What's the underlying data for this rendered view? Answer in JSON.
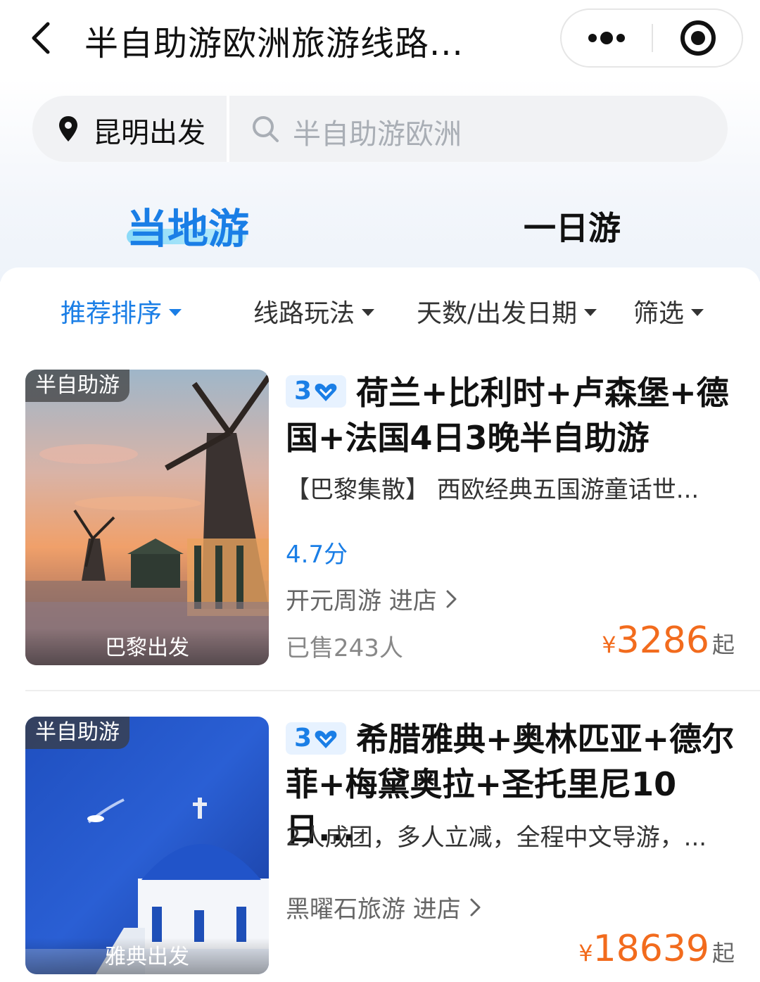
{
  "nav": {
    "title": "半自助游欧洲旅游线路...",
    "back_icon": "chevron-left-icon",
    "more_icon": "more-dots-icon",
    "target_icon": "target-icon"
  },
  "search": {
    "location": "昆明出发",
    "placeholder": "半自助游欧洲"
  },
  "tabs": [
    {
      "label": "当地游",
      "active": true
    },
    {
      "label": "一日游",
      "active": false
    }
  ],
  "filters": [
    {
      "label": "推荐排序",
      "active": true
    },
    {
      "label": "线路玩法",
      "active": false
    },
    {
      "label": "天数/出发日期",
      "active": false
    },
    {
      "label": "筛选",
      "active": false
    }
  ],
  "products": [
    {
      "tag": "半自助游",
      "from": "巴黎出发",
      "level": "3",
      "title": "荷兰+比利时+卢森堡+德国+法国4日3晚半自助游",
      "subtitle": "【巴黎集散】 西欧经典五国游童话世...",
      "score": "4.7分",
      "shop": "开元周游 进店",
      "sold": "已售243人",
      "currency": "¥",
      "price": "3286",
      "price_suffix": "起"
    },
    {
      "tag": "半自助游",
      "from": "雅典出发",
      "level": "3",
      "title": "希腊雅典+奥林匹亚+德尔菲+梅黛奥拉+圣托里尼10日...",
      "subtitle": "2人成团，多人立减，全程中文导游，...",
      "shop": "黑曜石旅游 进店",
      "currency": "¥",
      "price": "18639",
      "price_suffix": "起"
    }
  ],
  "colors": {
    "accent": "#1a7ee6",
    "price": "#f26b1d",
    "level_bg": "#e7f2ff"
  }
}
